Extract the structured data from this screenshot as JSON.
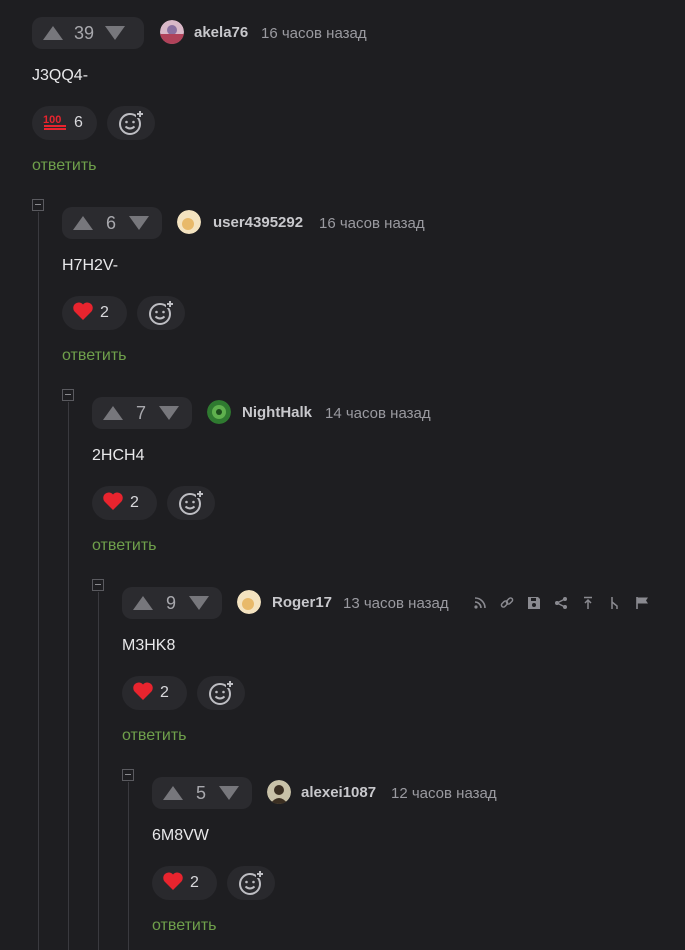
{
  "comments": [
    {
      "votes": "39",
      "user": "akela76",
      "time": "16 часов назад",
      "text": "J3QQ4-",
      "reaction_icon": "hundred-points-icon",
      "reaction_count": "6",
      "reply": "ответить",
      "avatar_color": "#c9a3b5"
    },
    {
      "votes": "6",
      "user": "user4395292",
      "time": "16 часов назад",
      "text": "H7H2V-",
      "reaction_icon": "heart-icon",
      "reaction_count": "2",
      "reply": "ответить",
      "avatar_color": "#e8c27a"
    },
    {
      "votes": "7",
      "user": "NightHalk",
      "time": "14 часов назад",
      "text": "2HCH4",
      "reaction_icon": "heart-icon",
      "reaction_count": "2",
      "reply": "ответить",
      "avatar_color": "#3c8a3a"
    },
    {
      "votes": "9",
      "user": "Roger17",
      "time": "13 часов назад",
      "text": "M3HK8",
      "reaction_icon": "heart-icon",
      "reaction_count": "2",
      "reply": "ответить",
      "avatar_color": "#e8c27a"
    },
    {
      "votes": "5",
      "user": "alexei1087",
      "time": "12 часов назад",
      "text": "6M8VW",
      "reaction_icon": "heart-icon",
      "reaction_count": "2",
      "reply": "ответить",
      "avatar_color": "#6b5a3a"
    }
  ],
  "colors": {
    "accent_reply": "#6fa04b",
    "heart": "#e8242e",
    "background": "#1e1e21"
  },
  "toolbar_icons": [
    "branch-icon",
    "link-icon",
    "save-icon",
    "share-icon",
    "to-top-icon",
    "thread-icon",
    "flag-icon"
  ]
}
